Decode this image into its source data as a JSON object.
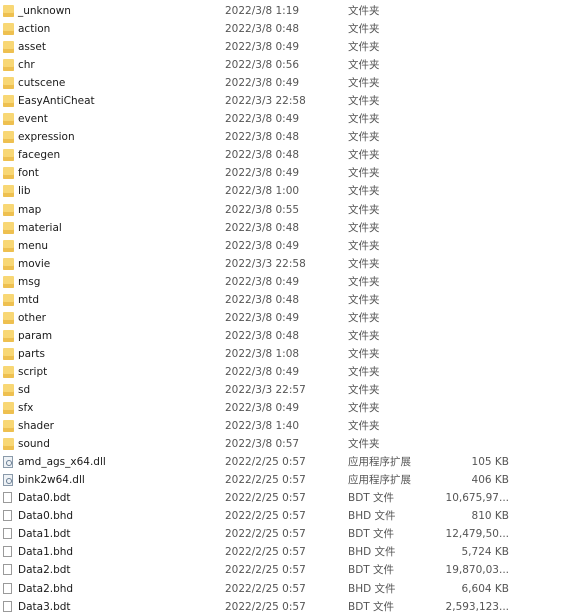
{
  "files": [
    {
      "name": "_unknown",
      "date": "2022/3/8 1:19",
      "type": "文件夹",
      "size": "",
      "icon": "folder-icon"
    },
    {
      "name": "action",
      "date": "2022/3/8 0:48",
      "type": "文件夹",
      "size": "",
      "icon": "folder-icon"
    },
    {
      "name": "asset",
      "date": "2022/3/8 0:49",
      "type": "文件夹",
      "size": "",
      "icon": "folder-icon"
    },
    {
      "name": "chr",
      "date": "2022/3/8 0:56",
      "type": "文件夹",
      "size": "",
      "icon": "folder-icon"
    },
    {
      "name": "cutscene",
      "date": "2022/3/8 0:49",
      "type": "文件夹",
      "size": "",
      "icon": "folder-icon"
    },
    {
      "name": "EasyAntiCheat",
      "date": "2022/3/3 22:58",
      "type": "文件夹",
      "size": "",
      "icon": "folder-icon"
    },
    {
      "name": "event",
      "date": "2022/3/8 0:49",
      "type": "文件夹",
      "size": "",
      "icon": "folder-icon"
    },
    {
      "name": "expression",
      "date": "2022/3/8 0:48",
      "type": "文件夹",
      "size": "",
      "icon": "folder-icon"
    },
    {
      "name": "facegen",
      "date": "2022/3/8 0:48",
      "type": "文件夹",
      "size": "",
      "icon": "folder-icon"
    },
    {
      "name": "font",
      "date": "2022/3/8 0:49",
      "type": "文件夹",
      "size": "",
      "icon": "folder-icon"
    },
    {
      "name": "lib",
      "date": "2022/3/8 1:00",
      "type": "文件夹",
      "size": "",
      "icon": "folder-icon"
    },
    {
      "name": "map",
      "date": "2022/3/8 0:55",
      "type": "文件夹",
      "size": "",
      "icon": "folder-icon"
    },
    {
      "name": "material",
      "date": "2022/3/8 0:48",
      "type": "文件夹",
      "size": "",
      "icon": "folder-icon"
    },
    {
      "name": "menu",
      "date": "2022/3/8 0:49",
      "type": "文件夹",
      "size": "",
      "icon": "folder-icon"
    },
    {
      "name": "movie",
      "date": "2022/3/3 22:58",
      "type": "文件夹",
      "size": "",
      "icon": "folder-icon"
    },
    {
      "name": "msg",
      "date": "2022/3/8 0:49",
      "type": "文件夹",
      "size": "",
      "icon": "folder-icon"
    },
    {
      "name": "mtd",
      "date": "2022/3/8 0:48",
      "type": "文件夹",
      "size": "",
      "icon": "folder-icon"
    },
    {
      "name": "other",
      "date": "2022/3/8 0:49",
      "type": "文件夹",
      "size": "",
      "icon": "folder-icon"
    },
    {
      "name": "param",
      "date": "2022/3/8 0:48",
      "type": "文件夹",
      "size": "",
      "icon": "folder-icon"
    },
    {
      "name": "parts",
      "date": "2022/3/8 1:08",
      "type": "文件夹",
      "size": "",
      "icon": "folder-icon"
    },
    {
      "name": "script",
      "date": "2022/3/8 0:49",
      "type": "文件夹",
      "size": "",
      "icon": "folder-icon"
    },
    {
      "name": "sd",
      "date": "2022/3/3 22:57",
      "type": "文件夹",
      "size": "",
      "icon": "folder-icon"
    },
    {
      "name": "sfx",
      "date": "2022/3/8 0:49",
      "type": "文件夹",
      "size": "",
      "icon": "folder-icon"
    },
    {
      "name": "shader",
      "date": "2022/3/8 1:40",
      "type": "文件夹",
      "size": "",
      "icon": "folder-icon"
    },
    {
      "name": "sound",
      "date": "2022/3/8 0:57",
      "type": "文件夹",
      "size": "",
      "icon": "folder-icon"
    },
    {
      "name": "amd_ags_x64.dll",
      "date": "2022/2/25 0:57",
      "type": "应用程序扩展",
      "size": "105 KB",
      "icon": "dll-icon"
    },
    {
      "name": "bink2w64.dll",
      "date": "2022/2/25 0:57",
      "type": "应用程序扩展",
      "size": "406 KB",
      "icon": "dll-icon"
    },
    {
      "name": "Data0.bdt",
      "date": "2022/2/25 0:57",
      "type": "BDT 文件",
      "size": "10,675,97...",
      "icon": "file-icon"
    },
    {
      "name": "Data0.bhd",
      "date": "2022/2/25 0:57",
      "type": "BHD 文件",
      "size": "810 KB",
      "icon": "file-icon"
    },
    {
      "name": "Data1.bdt",
      "date": "2022/2/25 0:57",
      "type": "BDT 文件",
      "size": "12,479,50...",
      "icon": "file-icon"
    },
    {
      "name": "Data1.bhd",
      "date": "2022/2/25 0:57",
      "type": "BHD 文件",
      "size": "5,724 KB",
      "icon": "file-icon"
    },
    {
      "name": "Data2.bdt",
      "date": "2022/2/25 0:57",
      "type": "BDT 文件",
      "size": "19,870,03...",
      "icon": "file-icon"
    },
    {
      "name": "Data2.bhd",
      "date": "2022/2/25 0:57",
      "type": "BHD 文件",
      "size": "6,604 KB",
      "icon": "file-icon"
    },
    {
      "name": "Data3.bdt",
      "date": "2022/2/25 0:57",
      "type": "BDT 文件",
      "size": "2,593,123...",
      "icon": "file-icon"
    }
  ]
}
